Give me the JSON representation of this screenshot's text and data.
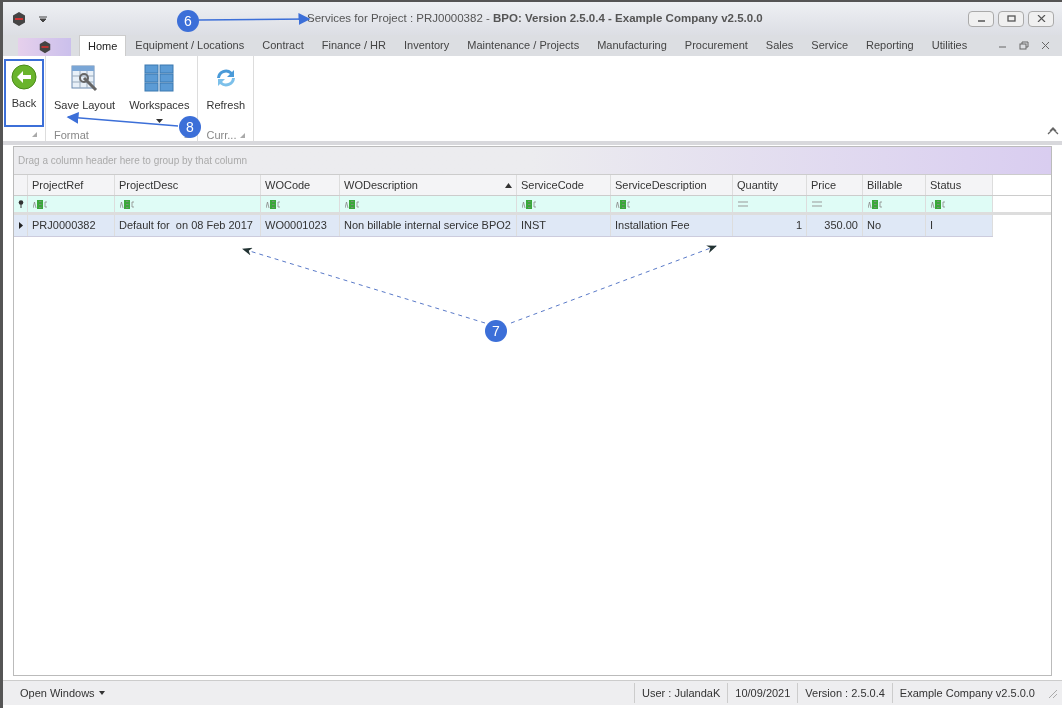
{
  "window": {
    "title": "Services for Project : PRJ0000382 - **BPO: Version 2.5.0.4 - Example Company v2.5.0.0**"
  },
  "tabs": [
    {
      "label": "Home",
      "selected": true
    },
    {
      "label": "Equipment / Locations",
      "selected": false
    },
    {
      "label": "Contract",
      "selected": false
    },
    {
      "label": "Finance / HR",
      "selected": false
    },
    {
      "label": "Inventory",
      "selected": false
    },
    {
      "label": "Maintenance / Projects",
      "selected": false
    },
    {
      "label": "Manufacturing",
      "selected": false
    },
    {
      "label": "Procurement",
      "selected": false
    },
    {
      "label": "Sales",
      "selected": false
    },
    {
      "label": "Service",
      "selected": false
    },
    {
      "label": "Reporting",
      "selected": false
    },
    {
      "label": "Utilities",
      "selected": false
    }
  ],
  "ribbon": {
    "groups": [
      {
        "buttons": [
          {
            "label": "Back",
            "kind": "back",
            "highlighted": true
          }
        ]
      },
      {
        "label": "Format",
        "buttons": [
          {
            "label": "Save Layout",
            "kind": "layout",
            "highlighted": false
          },
          {
            "label": "Workspaces",
            "kind": "grid",
            "highlighted": false,
            "dropdown": true
          }
        ]
      },
      {
        "label": "Curr...",
        "buttons": [
          {
            "label": "Refresh",
            "kind": "refresh",
            "highlighted": false
          }
        ]
      }
    ]
  },
  "grid": {
    "group_panel": "Drag a column header here to group by that column",
    "columns": [
      {
        "label": "ProjectRef",
        "kind": "text",
        "sorted": false
      },
      {
        "label": "ProjectDesc",
        "kind": "text",
        "sorted": false
      },
      {
        "label": "WOCode",
        "kind": "text",
        "sorted": false
      },
      {
        "label": "WODescription",
        "kind": "text",
        "sorted": true
      },
      {
        "label": "ServiceCode",
        "kind": "text",
        "sorted": false
      },
      {
        "label": "ServiceDescription",
        "kind": "text",
        "sorted": false
      },
      {
        "label": "Quantity",
        "kind": "number",
        "sorted": false
      },
      {
        "label": "Price",
        "kind": "number",
        "sorted": false
      },
      {
        "label": "Billable",
        "kind": "text",
        "sorted": false
      },
      {
        "label": "Status",
        "kind": "text",
        "sorted": false
      }
    ],
    "rows": [
      {
        "selected": true,
        "cells": [
          "PRJ0000382",
          "Default for  on 08 Feb 2017",
          "WO0001023",
          "Non billable internal service BPO2",
          "INST",
          "Installation Fee",
          "1",
          "350.00",
          "No",
          "I"
        ]
      }
    ]
  },
  "callouts": [
    {
      "label": "6"
    },
    {
      "label": "7"
    },
    {
      "label": "8"
    }
  ],
  "status_bar": {
    "open_windows": "Open Windows",
    "items": [
      "User : JulandaK",
      "10/09/2021",
      "Version : 2.5.0.4",
      "Example Company v2.5.0.0"
    ]
  }
}
